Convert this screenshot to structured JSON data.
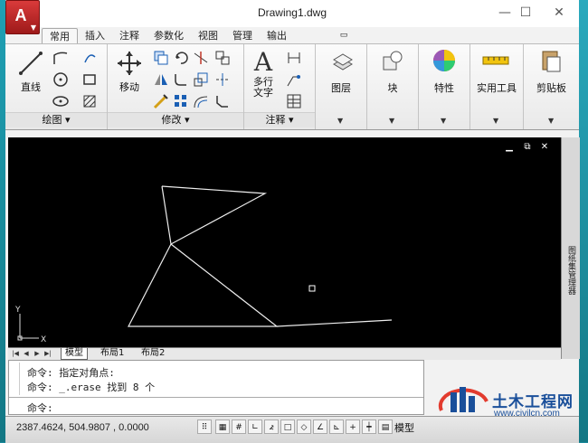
{
  "title": "Drawing1.dwg",
  "window_controls": {
    "minimize": "—",
    "maximize": "☐",
    "close": "✕"
  },
  "tabs": [
    "常用",
    "插入",
    "注释",
    "参数化",
    "视图",
    "管理",
    "输出"
  ],
  "ribbon": {
    "draw": {
      "line": "直线",
      "panel": "绘图 ▾"
    },
    "modify": {
      "move": "移动",
      "panel": "修改 ▾"
    },
    "annotation": {
      "big": "A",
      "text": "多行\n文字",
      "panel": "注释 ▾"
    },
    "layers": "图层",
    "block": "块",
    "properties": "特性",
    "utilities": "实用工具",
    "clipboard": "剪贴板"
  },
  "sidebar_label": "图纸集管理器",
  "layout_tabs": [
    "模型",
    "布局1",
    "布局2"
  ],
  "command_history": [
    "命令: 指定对角点:",
    "命令: _.erase 找到 8 个"
  ],
  "command_prompt": "命令:",
  "coordinates": "2387.4624, 504.9807 , 0.0000",
  "status_model": "模型",
  "ucs": {
    "y": "Y",
    "x": "X"
  },
  "watermark": {
    "title": "土木工程网",
    "url": "www.civilcn.com"
  }
}
